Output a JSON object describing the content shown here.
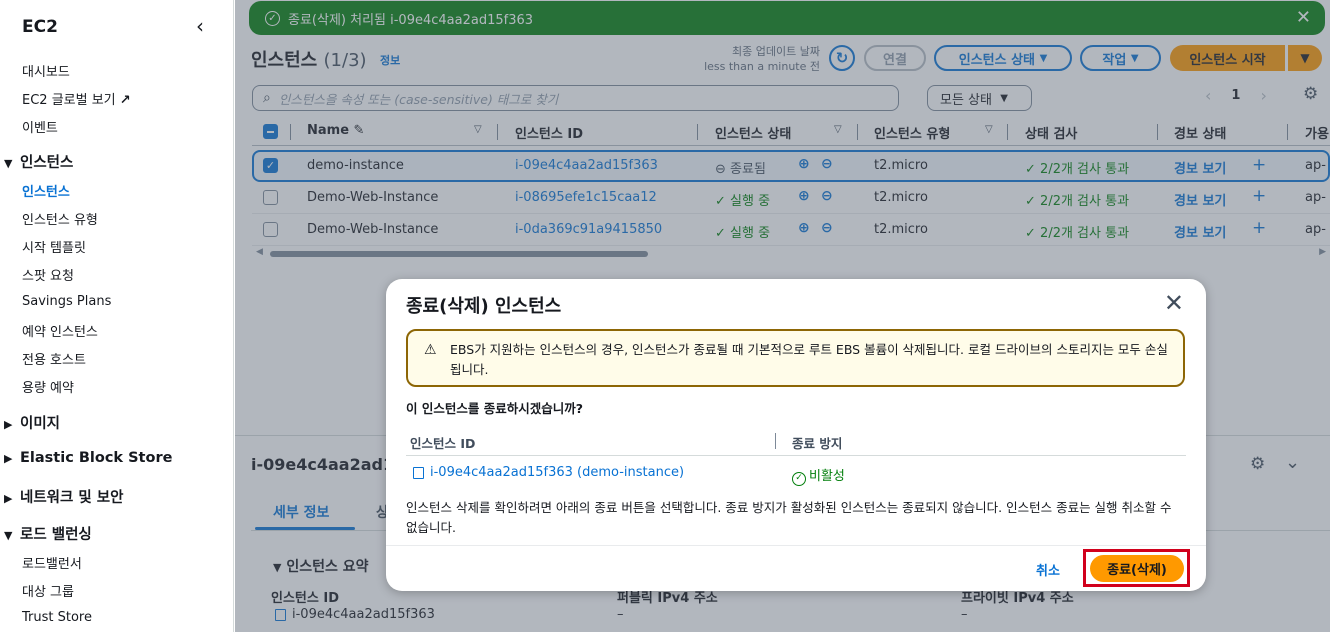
{
  "sidebar": {
    "title": "EC2",
    "collapse_icon": "chevron-left-icon",
    "top_items": [
      "대시보드",
      "EC2 글로벌 보기",
      "이벤트"
    ],
    "external_icon": "external-link-icon",
    "section_instances": "인스턴스",
    "instances_items": [
      "인스턴스",
      "인스턴스 유형",
      "시작 템플릿",
      "스팟 요청",
      "Savings Plans",
      "예약 인스턴스",
      "전용 호스트",
      "용량 예약"
    ],
    "section_images": "이미지",
    "section_ebs": "Elastic Block Store",
    "section_network": "네트워크 및 보안",
    "section_lb": "로드 밸런싱",
    "lb_items": [
      "로드밸런서",
      "대상 그룹",
      "Trust Store"
    ]
  },
  "flash": {
    "message": "종료(삭제) 처리됨 i-09e4c4aa2ad15f363",
    "status_color": "#037f0c"
  },
  "header": {
    "title": "인스턴스",
    "count": "(1/3)",
    "info": "정보",
    "last_updated_label": "최종 업데이트 날짜",
    "last_updated_value": "less than a minute 전",
    "connect": "연결",
    "instance_state": "인스턴스 상태",
    "actions": "작업",
    "launch": "인스턴스 시작"
  },
  "search": {
    "placeholder": "인스턴스을 속성 또는 (case-sensitive) 태그로 찾기"
  },
  "filter": {
    "selected": "모든 상태"
  },
  "pagination": {
    "page": "1"
  },
  "table": {
    "columns": [
      "Name",
      "인스턴스 ID",
      "인스턴스 상태",
      "인스턴스 유형",
      "상태 검사",
      "경보 상태",
      "가용"
    ],
    "rows": [
      {
        "name": "demo-instance",
        "id": "i-09e4c4aa2ad15f363",
        "state": "종료됨",
        "type": "t2.micro",
        "check": "2/2개 검사 통과",
        "alarm": "경보 보기",
        "az": "ap-"
      },
      {
        "name": "Demo-Web-Instance",
        "id": "i-08695efe1c15caa12",
        "state": "실행 중",
        "type": "t2.micro",
        "check": "2/2개 검사 통과",
        "alarm": "경보 보기",
        "az": "ap-"
      },
      {
        "name": "Demo-Web-Instance",
        "id": "i-0da369c91a9415850",
        "state": "실행 중",
        "type": "t2.micro",
        "check": "2/2개 검사 통과",
        "alarm": "경보 보기",
        "az": "ap-"
      }
    ]
  },
  "detail": {
    "instance_id": "i-09e4c4aa2ad1",
    "tab_details": "세부 정보",
    "tab_next": "상",
    "summary": "인스턴스 요약",
    "label_id": "인스턴스 ID",
    "value_id": "i-09e4c4aa2ad15f363",
    "label_public": "퍼블릭 IPv4 주소",
    "value_public": "–",
    "label_private": "프라이빗 IPv4 주소",
    "value_private": "–"
  },
  "modal": {
    "title": "종료(삭제) 인스턴스",
    "warning": "EBS가 지원하는 인스턴스의 경우, 인스턴스가 종료될 때 기본적으로 루트 EBS 볼륨이 삭제됩니다. 로컬 드라이브의 스토리지는 모두 손실됩니다.",
    "question": "이 인스턴스를 종료하시겠습니까?",
    "col_id": "인스턴스 ID",
    "col_protection": "종료 방지",
    "instance_link": "i-09e4c4aa2ad15f363 (demo-instance)",
    "protection_value": "비활성",
    "note": "인스턴스 삭제를 확인하려면 아래의 종료 버튼을 선택합니다. 종료 방지가 활성화된 인스턴스는 종료되지 않습니다. 인스턴스 종료는 실행 취소할 수 없습니다.",
    "cancel": "취소",
    "confirm": "종료(삭제)"
  },
  "colors": {
    "link": "#0972d3",
    "primary": "#ff9900",
    "success": "#037f0c",
    "highlight": "#d1001c"
  }
}
